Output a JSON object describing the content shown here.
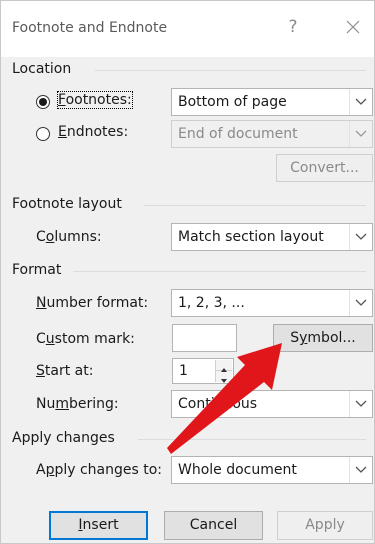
{
  "dialog": {
    "title": "Footnote and Endnote",
    "help_glyph": "?",
    "close_glyph": "✕"
  },
  "location": {
    "heading": "Location",
    "footnotes_label": "Footnotes:",
    "footnotes_value": "Bottom of page",
    "footnotes_checked": true,
    "endnotes_label": "Endnotes:",
    "endnotes_value": "End of document",
    "endnotes_checked": false,
    "convert_label": "Convert..."
  },
  "footnote_layout": {
    "heading": "Footnote layout",
    "columns_label": "Columns:",
    "columns_value": "Match section layout"
  },
  "format": {
    "heading": "Format",
    "number_format_label": "Number format:",
    "number_format_value": "1, 2, 3, ...",
    "custom_mark_label": "Custom mark:",
    "custom_mark_value": "",
    "symbol_label": "Symbol...",
    "start_at_label": "Start at:",
    "start_at_value": "1",
    "numbering_label": "Numbering:",
    "numbering_value": "Continuous"
  },
  "apply_changes": {
    "heading": "Apply changes",
    "apply_to_label": "Apply changes to:",
    "apply_to_value": "Whole document"
  },
  "buttons": {
    "insert": "Insert",
    "cancel": "Cancel",
    "apply": "Apply"
  },
  "colors": {
    "dialog_bg": "#f0f0f0",
    "default_button_border": "#0078d7",
    "annotation_arrow": "#e0161b"
  },
  "icons": {
    "help": "question-mark-icon",
    "close": "close-icon",
    "dropdown": "chevron-down-icon",
    "spinner": "spinner-arrows-icon",
    "annotation": "red-arrow-annotation-icon"
  }
}
